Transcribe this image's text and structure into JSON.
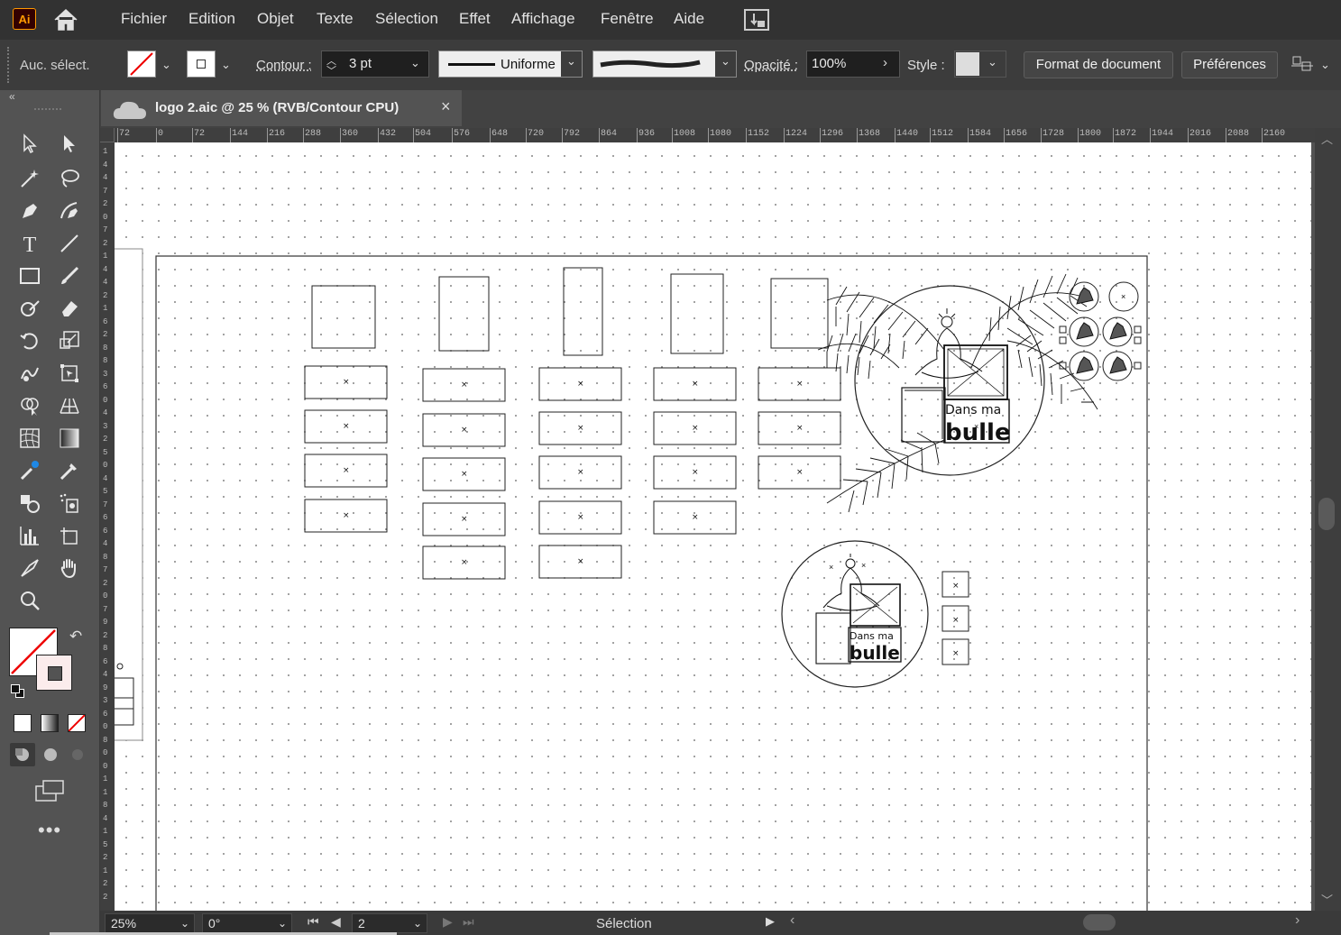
{
  "app": {
    "logo_text": "Ai"
  },
  "menu": [
    "Fichier",
    "Edition",
    "Objet",
    "Texte",
    "Sélection",
    "Effet",
    "Affichage",
    "Fenêtre",
    "Aide"
  ],
  "control": {
    "selection_label": "Auc. sélect.",
    "stroke_label": "Contour :",
    "stroke_weight": "3 pt",
    "profile": "Uniforme",
    "opacity_label": "Opacité :",
    "opacity_value": "100%",
    "style_label": "Style :",
    "doc_setup_button": "Format de document",
    "preferences_button": "Préférences"
  },
  "document_tab": {
    "title": "logo 2.aic @ 25 % (RVB/Contour CPU)",
    "close": "×"
  },
  "ruler_top_labels": [
    "72",
    "0",
    "72",
    "144",
    "216",
    "288",
    "360",
    "432",
    "504",
    "576",
    "648",
    "720",
    "792",
    "864",
    "936",
    "1008",
    "1080",
    "1152",
    "1224",
    "1296",
    "1368",
    "1440",
    "1512",
    "1584",
    "1656",
    "1728",
    "1800",
    "1872",
    "1944",
    "2016",
    "2088",
    "2160"
  ],
  "ruler_left_labels": [
    "1",
    "4",
    "4",
    "7",
    "2",
    "0",
    "7",
    "2",
    "1",
    "4",
    "4",
    "2",
    "1",
    "6",
    "2",
    "8",
    "8",
    "3",
    "6",
    "0",
    "4",
    "3",
    "2",
    "5",
    "0",
    "4",
    "5",
    "7",
    "6",
    "6",
    "4",
    "8",
    "7",
    "2",
    "0",
    "7",
    "9",
    "2",
    "8",
    "6",
    "4",
    "9",
    "3",
    "6",
    "0",
    "8",
    "0",
    "0",
    "1",
    "1",
    "8",
    "4",
    "1",
    "5",
    "2",
    "1",
    "2",
    "2"
  ],
  "artwork": {
    "logo_text_line1": "Dans ma",
    "logo_text_line2": "bulle",
    "marker": "×"
  },
  "status": {
    "zoom": "25%",
    "rotation": "0°",
    "artboard": "2",
    "tool_name": "Sélection"
  }
}
